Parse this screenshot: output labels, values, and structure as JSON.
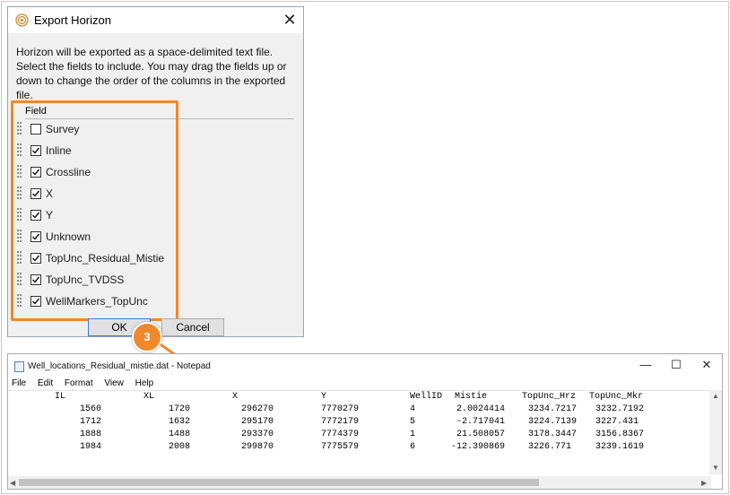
{
  "dialog": {
    "title": "Export Horizon",
    "close_glyph": "✕",
    "description": "Horizon will be exported as a space-delimited text file. Select the fields to include. You may drag the fields up or down to change the order of the columns in the exported file.",
    "field_header": "Field",
    "fields": [
      {
        "label": "Survey",
        "checked": false
      },
      {
        "label": "Inline",
        "checked": true
      },
      {
        "label": "Crossline",
        "checked": true
      },
      {
        "label": "X",
        "checked": true
      },
      {
        "label": "Y",
        "checked": true
      },
      {
        "label": "Unknown",
        "checked": true
      },
      {
        "label": "TopUnc_Residual_Mistie",
        "checked": true
      },
      {
        "label": "TopUnc_TVDSS",
        "checked": true
      },
      {
        "label": "WellMarkers_TopUnc",
        "checked": true
      }
    ],
    "ok_label": "OK",
    "cancel_label": "Cancel"
  },
  "callout": {
    "number": "3",
    "color": "#f0882d"
  },
  "notepad": {
    "title": "Well_locations_Residual_mistie.dat - Notepad",
    "menu": [
      "File",
      "Edit",
      "Format",
      "View",
      "Help"
    ],
    "columns": [
      "IL",
      "XL",
      "X",
      "Y",
      "WellID",
      "Mistie",
      "TopUnc_Hrz",
      "TopUnc_Mkr"
    ],
    "rows": [
      [
        "1560",
        "1720",
        "296270",
        "7770279",
        "4",
        "2.0024414",
        "3234.7217",
        "3232.7192"
      ],
      [
        "1712",
        "1632",
        "295170",
        "7772179",
        "5",
        "-2.717041",
        "3224.7139",
        "3227.431"
      ],
      [
        "1888",
        "1488",
        "293370",
        "7774379",
        "1",
        "21.508057",
        "3178.3447",
        "3156.8367"
      ],
      [
        "1984",
        "2008",
        "299870",
        "7775579",
        "6",
        "-12.390869",
        "3226.771",
        "3239.1619"
      ]
    ],
    "minimize_glyph": "—",
    "maximize_glyph": "☐",
    "close_glyph": "✕"
  }
}
